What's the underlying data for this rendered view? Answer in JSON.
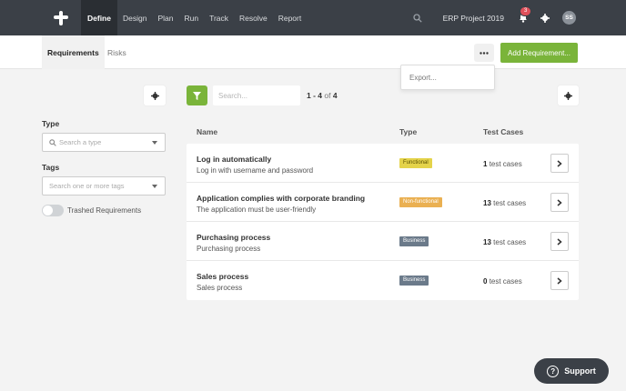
{
  "nav": {
    "items": [
      "Define",
      "Design",
      "Plan",
      "Run",
      "Track",
      "Resolve",
      "Report"
    ],
    "project": "ERP Project 2019",
    "notification_count": "3",
    "avatar_initials": "SS"
  },
  "subheader": {
    "tabs": [
      "Requirements",
      "Risks"
    ],
    "add_label": "Add Requirement...",
    "more_icon": "ellipsis-icon"
  },
  "dropdown": {
    "export_label": "Export..."
  },
  "filters": {
    "type_label": "Type",
    "type_placeholder": "Search a type",
    "tags_label": "Tags",
    "tags_placeholder": "Search one or more tags",
    "trashed_label": "Trashed Requirements"
  },
  "toolbar": {
    "search_placeholder": "Search...",
    "range": "1 - 4",
    "of": "of",
    "total": "4"
  },
  "table": {
    "headers": {
      "name": "Name",
      "type": "Type",
      "test_cases": "Test Cases"
    },
    "rows": [
      {
        "name": "Log in automatically",
        "desc": "Log in with username and password",
        "type": "Functional",
        "count": "1",
        "unit": "test cases"
      },
      {
        "name": "Application complies with corporate branding",
        "desc": "The application must be user-friendly",
        "type": "Non-functional",
        "count": "13",
        "unit": "test cases"
      },
      {
        "name": "Purchasing process",
        "desc": "Purchasing process",
        "type": "Business",
        "count": "13",
        "unit": "test cases"
      },
      {
        "name": "Sales process",
        "desc": "Sales process",
        "type": "Business",
        "count": "0",
        "unit": "test cases"
      }
    ]
  },
  "support": {
    "label": "Support"
  },
  "colors": {
    "accent_green": "#7ab43a",
    "nav_bg": "#3b4047",
    "functional": "#e4d34a",
    "non_functional": "#eab052",
    "business": "#6b7a8a"
  }
}
